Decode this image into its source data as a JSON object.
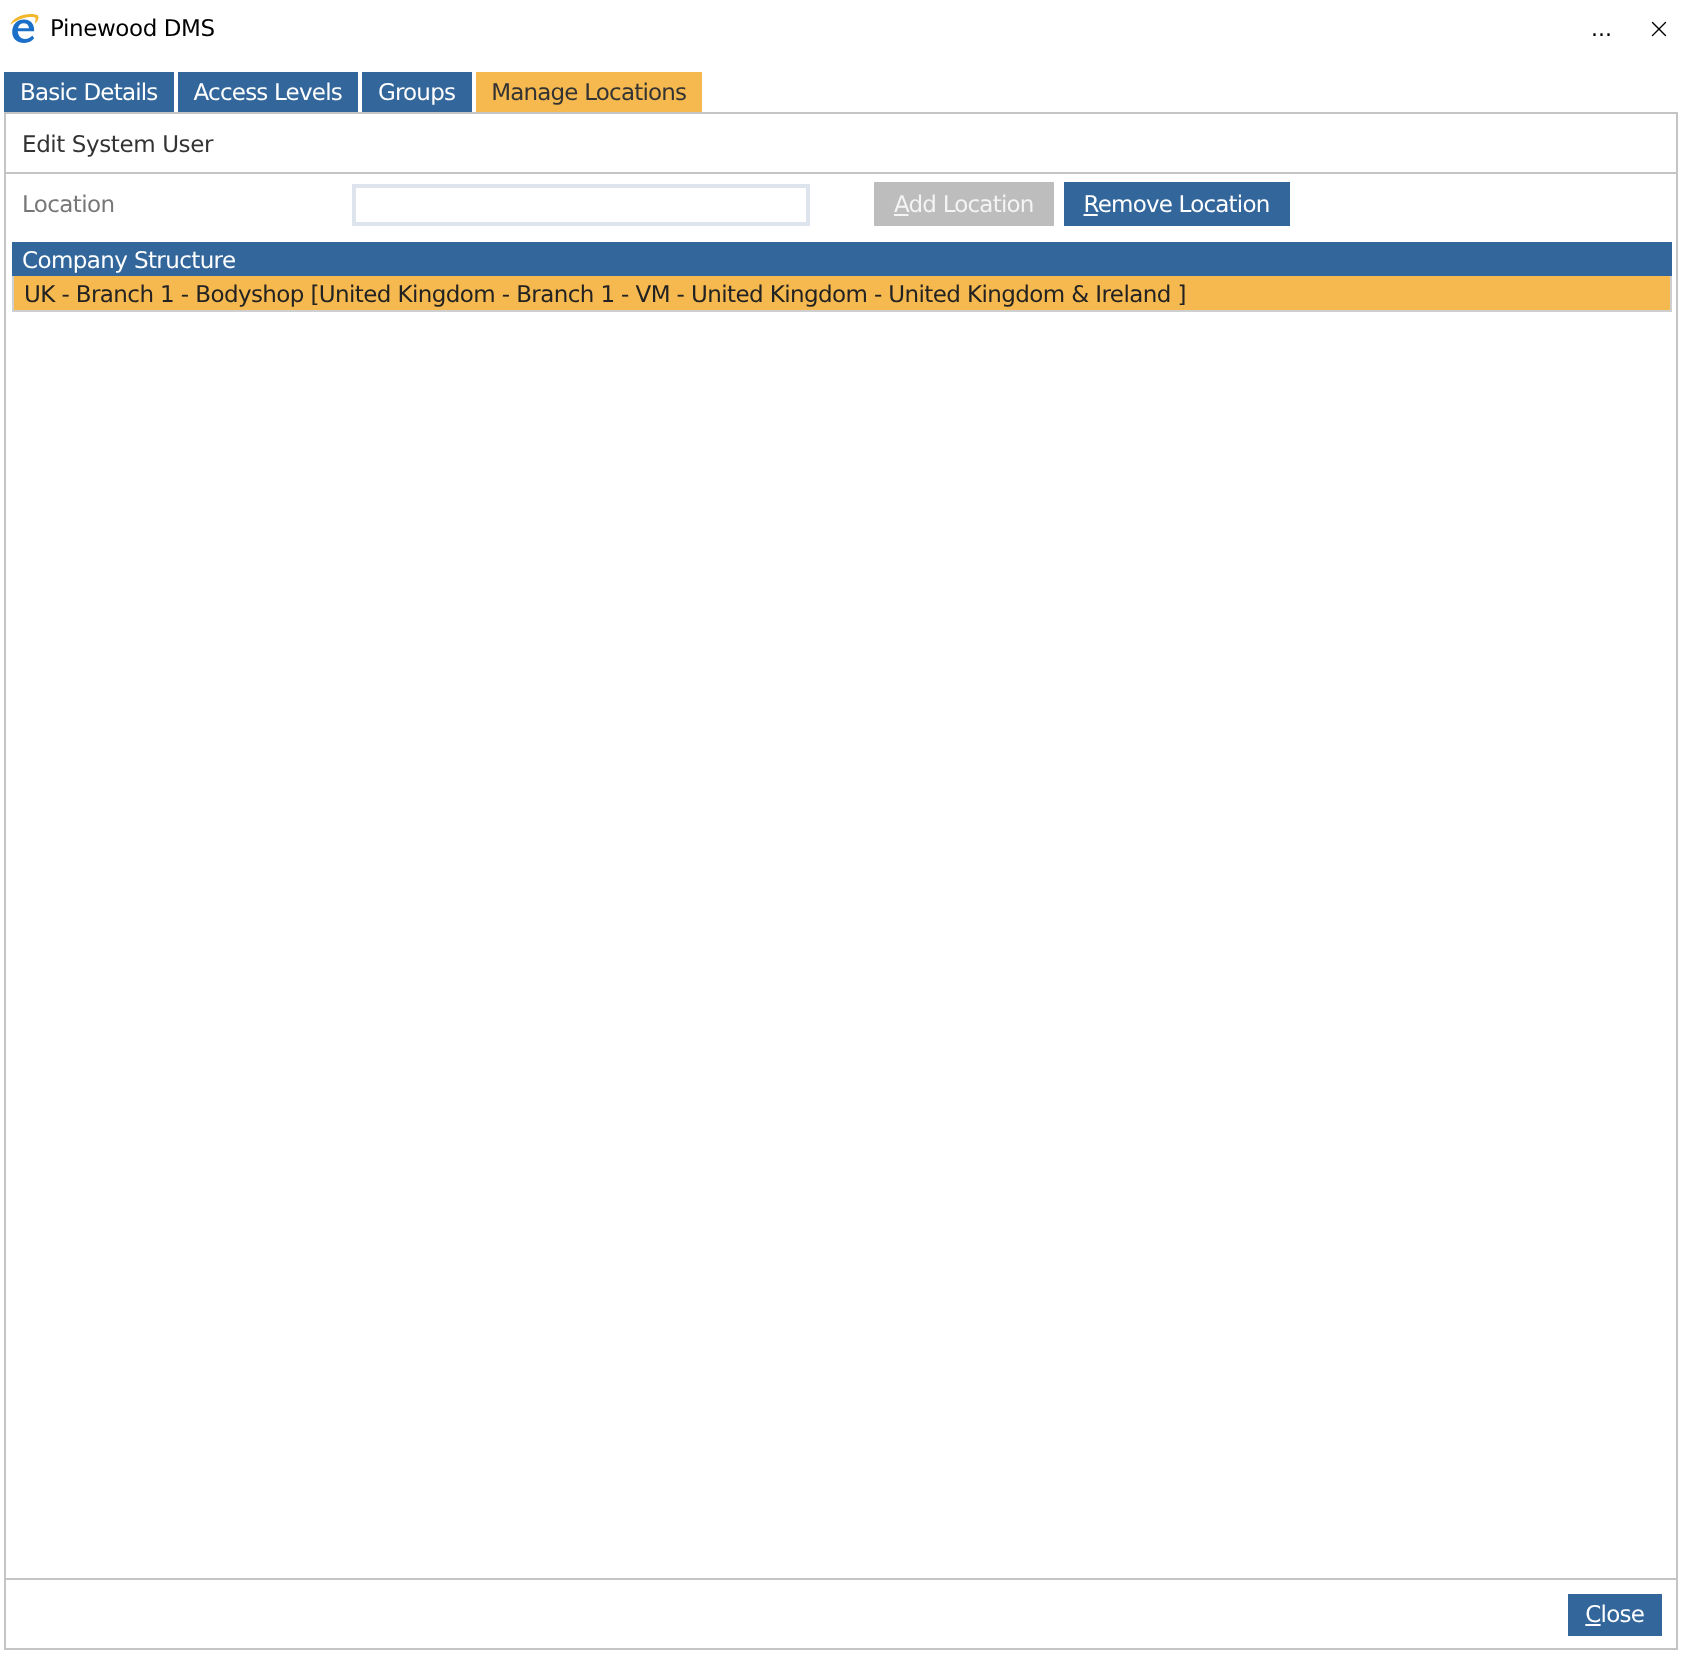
{
  "window": {
    "title": "Pinewood DMS",
    "more_glyph": "..."
  },
  "tabs": [
    {
      "label": "Basic Details",
      "selected": false
    },
    {
      "label": "Access Levels",
      "selected": false
    },
    {
      "label": "Groups",
      "selected": false
    },
    {
      "label": "Manage Locations",
      "selected": true
    }
  ],
  "panel": {
    "header": "Edit System User",
    "location_label": "Location",
    "buttons": [
      {
        "label": "Add Location",
        "disabled": true,
        "mnemonic": true
      },
      {
        "label": "Remove Location",
        "disabled": false,
        "mnemonic": true
      }
    ]
  },
  "grid": {
    "columns": [
      "Company Structure"
    ],
    "rows": [
      {
        "text": "UK - Branch 1 - Bodyshop [United Kingdom - Branch 1 - VM - United Kingdom - United Kingdom & Ireland ]",
        "selected": true
      }
    ]
  },
  "footer": {
    "buttons": [
      {
        "label": "Close",
        "disabled": false,
        "mnemonic": true
      }
    ]
  }
}
